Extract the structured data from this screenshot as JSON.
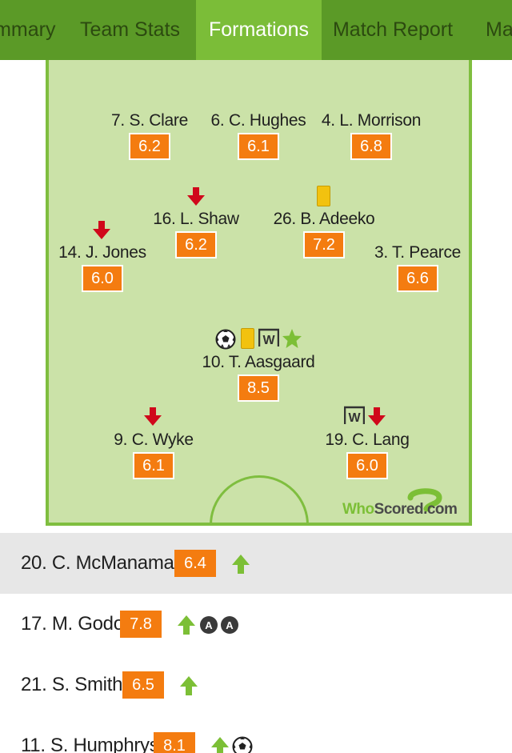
{
  "tabs": [
    {
      "label": "Summary",
      "active": false
    },
    {
      "label": "Team Stats",
      "active": false
    },
    {
      "label": "Formations",
      "active": true
    },
    {
      "label": "Match Report",
      "active": false
    },
    {
      "label": "Match",
      "active": false
    }
  ],
  "players": [
    {
      "name": "7. S. Clare",
      "rating": "6.2"
    },
    {
      "name": "6. C. Hughes",
      "rating": "6.1"
    },
    {
      "name": "4. L. Morrison",
      "rating": "6.8"
    },
    {
      "name": "16. L. Shaw",
      "rating": "6.2"
    },
    {
      "name": "26. B. Adeeko",
      "rating": "7.2"
    },
    {
      "name": "14. J. Jones",
      "rating": "6.0"
    },
    {
      "name": "3. T. Pearce",
      "rating": "6.6"
    },
    {
      "name": "10. T. Aasgaard",
      "rating": "8.5"
    },
    {
      "name": "9. C. Wyke",
      "rating": "6.1"
    },
    {
      "name": "19. C. Lang",
      "rating": "6.0"
    }
  ],
  "logo": {
    "who": "Who",
    "scored": "Scored",
    "dotcom": ".com"
  },
  "substitutes": [
    {
      "name": "20. C. McManaman",
      "rating": "6.4"
    },
    {
      "name": "17. M. Godo",
      "rating": "7.8",
      "badge": "A"
    },
    {
      "name": "21. S. Smith",
      "rating": "6.5"
    },
    {
      "name": "11. S. Humphrys",
      "rating": "8.1"
    }
  ],
  "colors": {
    "tab_bar": "#5b9a27",
    "tab_active": "#7bbd38",
    "pitch": "#cbe2a8",
    "pitch_line": "#7fbe3f",
    "rating_badge": "#f47c10",
    "sub_arrow": "#7cbf36",
    "off_arrow": "#d0081b",
    "yellow_card": "#f2c20f"
  }
}
